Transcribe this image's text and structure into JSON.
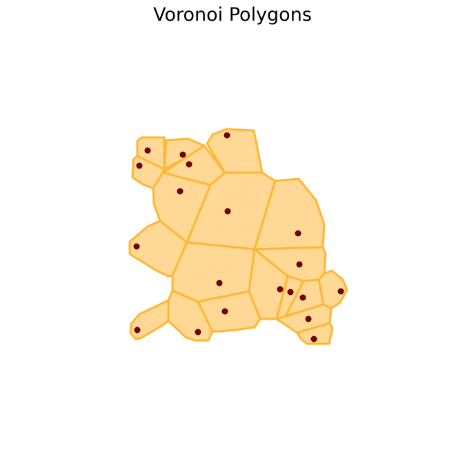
{
  "title": "Voronoi Polygons",
  "colors": {
    "cell_fill": "#fed894",
    "cell_stroke": "#ffb733",
    "outer_stroke": "#fed07a",
    "point_fill": "#800000",
    "point_stroke": "#4a0000",
    "background": "#ffffff"
  },
  "cell_count": 20,
  "point_count": 20,
  "legend": "none",
  "axes": "hidden"
}
